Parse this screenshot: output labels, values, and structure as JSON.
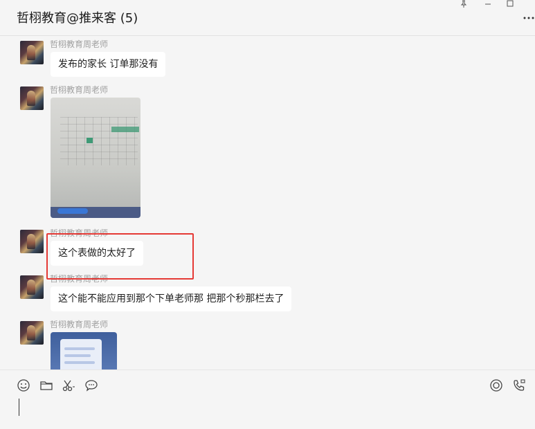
{
  "header": {
    "title": "哲栩教育@推来客 (5)",
    "window_controls": [
      "pin-icon",
      "minimize-icon",
      "maximize-icon"
    ],
    "more_icon": "more-dots-icon"
  },
  "messages": [
    {
      "sender": "哲栩教育周老师",
      "type": "text",
      "text": "发布的家长 订单那没有"
    },
    {
      "sender": "哲栩教育周老师",
      "type": "image"
    },
    {
      "sender": "哲栩教育周老师",
      "type": "text",
      "text": "这个表做的太好了",
      "highlighted": true
    },
    {
      "sender": "哲栩教育周老师",
      "type": "text",
      "text": "这个能不能应用到那个下单老师那 把那个秒那栏去了"
    },
    {
      "sender": "哲栩教育周老师",
      "type": "image"
    }
  ],
  "toolbar": {
    "left_icons": [
      "emoji-icon",
      "folder-icon",
      "scissors-icon",
      "chat-bubble-icon"
    ],
    "right_icons": [
      "record-icon",
      "call-icon"
    ]
  },
  "colors": {
    "highlight": "#e53935",
    "background": "#f5f5f5",
    "bubble": "#ffffff",
    "sender": "#a0a0a0"
  }
}
